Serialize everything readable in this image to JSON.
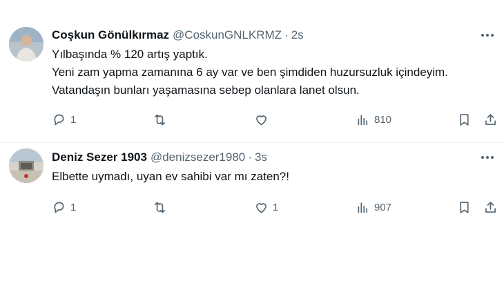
{
  "tweets": [
    {
      "name": "Coşkun Gönülkırmaz",
      "handle": "@CoskunGNLKRMZ",
      "separator": "·",
      "time": "2s",
      "lines": [
        "Yılbaşında % 120 artış yaptık.",
        "Yeni zam yapma zamanına 6 ay var ve ben şimdiden huzursuzluk içindeyim.",
        "Vatandaşın bunları yaşamasına sebep olanlara lanet olsun."
      ],
      "replies": "1",
      "retweets": "",
      "likes": "",
      "views": "810"
    },
    {
      "name": "Deniz Sezer 1903",
      "handle": "@denizsezer1980",
      "separator": "·",
      "time": "3s",
      "lines": [
        "Elbette uymadı, uyan ev sahibi var mı zaten?!"
      ],
      "replies": "1",
      "retweets": "",
      "likes": "1",
      "views": "907"
    }
  ],
  "icons": {
    "reply": "speech-bubble-icon",
    "retweet": "retweet-arrows-icon",
    "like": "heart-icon",
    "views": "bar-chart-icon",
    "bookmark": "bookmark-icon",
    "share": "share-upload-icon",
    "more": "more-dots-icon"
  },
  "colors": {
    "text": "#0f1419",
    "secondary": "#536471",
    "divider": "#eff3f4"
  }
}
